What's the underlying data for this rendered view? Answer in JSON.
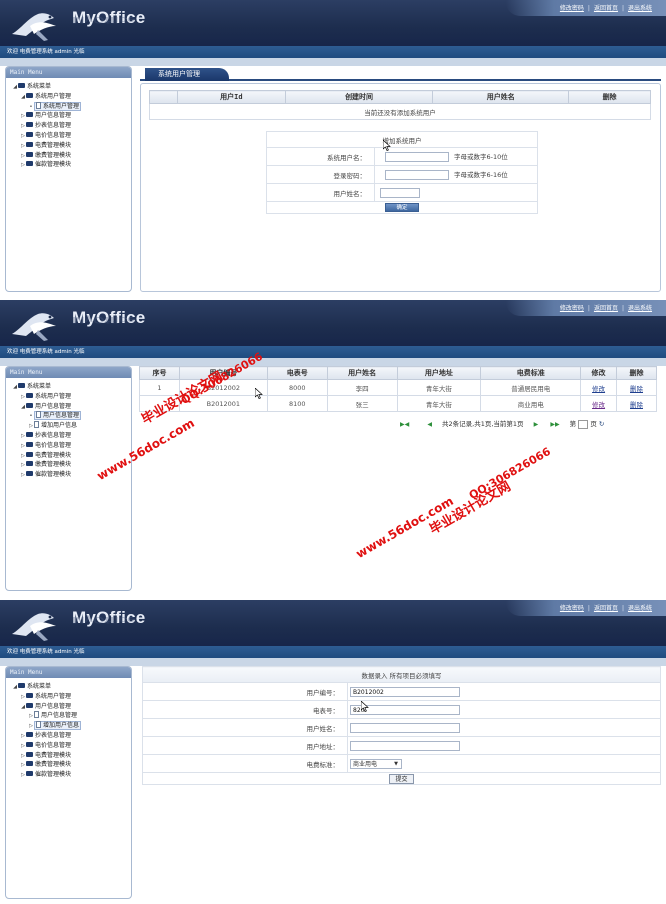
{
  "app": {
    "brand": "MyOffice",
    "welcome": "欢迎 电费管理系统 admin 光临",
    "top_links": [
      "修改密码",
      "返回首页",
      "退出系统"
    ],
    "sidebar_title": "Main Menu"
  },
  "screen1": {
    "tree": [
      {
        "label": "系统菜单"
      },
      {
        "label": "系统用户管理"
      },
      {
        "label": "系统用户管理"
      },
      {
        "label": "用户信息管理"
      },
      {
        "label": "抄表信息管理"
      },
      {
        "label": "电价信息管理"
      },
      {
        "label": "电费管理模块"
      },
      {
        "label": "缴费管理模块"
      },
      {
        "label": "催款管理模块"
      }
    ],
    "tab": "系统用户管理",
    "columns": [
      "用户Id",
      "创建时间",
      "用户姓名",
      "删除"
    ],
    "empty_message": "当前还没有添加系统用户",
    "form": {
      "title": "增加系统用户",
      "fields": [
        {
          "label": "系统用户名：",
          "hint": "字母或数字6-10位"
        },
        {
          "label": "登录密码：",
          "hint": "字母或数字6-16位"
        },
        {
          "label": "用户姓名：",
          "hint": ""
        }
      ],
      "submit": "确定"
    }
  },
  "screen2": {
    "tree": [
      {
        "label": "系统菜单"
      },
      {
        "label": "系统用户管理"
      },
      {
        "label": "用户信息管理"
      },
      {
        "label": "用户信息管理"
      },
      {
        "label": "增加用户信息"
      },
      {
        "label": "抄表信息管理"
      },
      {
        "label": "电价信息管理"
      },
      {
        "label": "电费管理模块"
      },
      {
        "label": "缴费管理模块"
      },
      {
        "label": "催款管理模块"
      }
    ],
    "columns": [
      "序号",
      "用户编号",
      "电表号",
      "用户姓名",
      "用户地址",
      "电费标准",
      "修改",
      "删除"
    ],
    "rows": [
      {
        "no": "1",
        "user_id": "B2012002",
        "meter": "8000",
        "name": "李四",
        "address": "青年大街",
        "rate": "普通居民用电",
        "edit": "修改",
        "del": "删除"
      },
      {
        "no": "",
        "user_id": "B2012001",
        "meter": "8100",
        "name": "张三",
        "address": "青年大街",
        "rate": "商业用电",
        "edit": "修改",
        "del": "删除"
      }
    ],
    "pager": {
      "summary": "共2条记录,共1页,当前第1页",
      "goto_prefix": "第",
      "goto_suffix": "页"
    },
    "watermarks": [
      "毕业设计论文网",
      "QQ:306826066",
      "www.56doc.com"
    ]
  },
  "screen3": {
    "tree": [
      {
        "label": "系统菜单"
      },
      {
        "label": "系统用户管理"
      },
      {
        "label": "用户信息管理"
      },
      {
        "label": "用户信息管理"
      },
      {
        "label": "增加用户信息"
      },
      {
        "label": "抄表信息管理"
      },
      {
        "label": "电价信息管理"
      },
      {
        "label": "电费管理模块"
      },
      {
        "label": "缴费管理模块"
      },
      {
        "label": "催款管理模块"
      }
    ],
    "form": {
      "title": "数据录入 所有项目必须填写",
      "fields": [
        {
          "label": "用户编号：",
          "value": "B2012002"
        },
        {
          "label": "电表号：",
          "value": "820"
        },
        {
          "label": "用户姓名：",
          "value": ""
        },
        {
          "label": "用户地址：",
          "value": ""
        }
      ],
      "rate_label": "电费标准：",
      "rate_selected": "商业用电",
      "submit": "提交"
    }
  }
}
